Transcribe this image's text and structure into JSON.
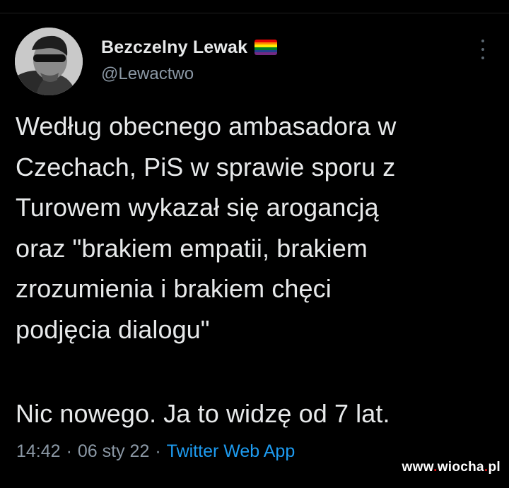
{
  "tweet": {
    "author": {
      "display_name": "Bezczelny Lewak",
      "handle": "@Lewactwo",
      "flag_colors": [
        "#e40303",
        "#ff8c00",
        "#ffed00",
        "#008026",
        "#24408e",
        "#732982"
      ]
    },
    "text": "Według obecnego ambasadora w\nCzechach, PiS w sprawie sporu z\nTurowem wykazał się arogancją\noraz \"brakiem empatii, brakiem\nzrozumienia i brakiem chęci\npodjęcia dialogu\"",
    "text_second": "Nic nowego. Ja to widzę od 7 lat.",
    "time": "14:42",
    "date": "06 sty 22",
    "source": "Twitter Web App",
    "separator": "·"
  },
  "watermark": {
    "prefix": "www",
    "dot1": ".",
    "middle": "wiocha",
    "dot2": ".",
    "suffix": "pl"
  },
  "colors": {
    "background": "#000000",
    "text": "#e7e9ea",
    "muted": "#8b98a5",
    "link": "#1d9bf0"
  }
}
